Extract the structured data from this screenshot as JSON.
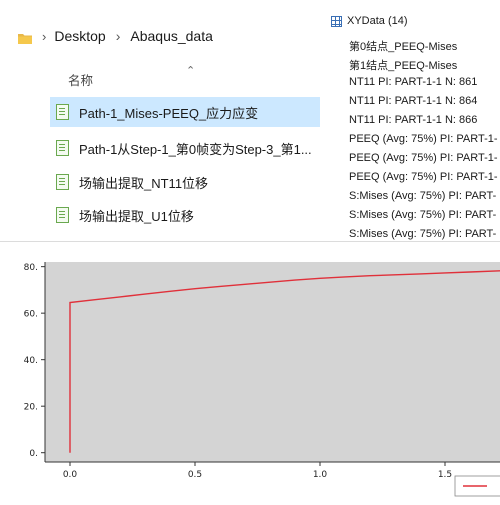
{
  "explorer": {
    "breadcrumb": [
      "Desktop",
      "Abaqus_data"
    ],
    "column_header": "名称",
    "files": [
      "Path-1_Mises-PEEQ_应力应变",
      "Path-1从Step-1_第0帧变为Step-3_第1...",
      "场输出提取_NT11位移",
      "场输出提取_U1位移"
    ],
    "selected_index": 0
  },
  "xydata_tree": {
    "root": "XYData (14)",
    "items": [
      "第0结点_PEEQ-Mises",
      "第1结点_PEEQ-Mises",
      "NT11 PI: PART-1-1 N: 861",
      "NT11 PI: PART-1-1 N: 864",
      "NT11 PI: PART-1-1 N: 866",
      "PEEQ (Avg: 75%) PI: PART-1-",
      "PEEQ (Avg: 75%) PI: PART-1-",
      "PEEQ (Avg: 75%) PI: PART-1-",
      "S:Mises (Avg: 75%) PI: PART-",
      "S:Mises (Avg: 75%) PI: PART-",
      "S:Mises (Avg: 75%) PI: PART-"
    ]
  },
  "chart_data": {
    "type": "line",
    "xlim": [
      -0.1,
      1.72
    ],
    "ylim": [
      -4,
      82
    ],
    "xticks": [
      0.0,
      0.5,
      1.0,
      1.5
    ],
    "xtick_labels": [
      "0.0",
      "0.5",
      "1.0",
      "1.5"
    ],
    "yticks": [
      0,
      20,
      40,
      60,
      80
    ],
    "ytick_labels": [
      "0.",
      "20.",
      "40.",
      "60.",
      "80."
    ],
    "grid": false,
    "legend": "bottom-right",
    "background": "#d4d4d4",
    "series": [
      {
        "color": "#e0303a",
        "x": [
          0.0,
          0.0,
          0.0,
          0.1,
          0.2,
          0.3,
          0.4,
          0.5,
          0.6,
          0.7,
          0.8,
          0.9,
          1.0,
          1.1,
          1.2,
          1.3,
          1.4,
          1.5,
          1.6,
          1.72
        ],
        "y": [
          0,
          64,
          64.6,
          65.8,
          67.0,
          68.2,
          69.4,
          70.5,
          71.5,
          72.4,
          73.3,
          74.2,
          75.0,
          75.6,
          76.1,
          76.5,
          76.9,
          77.3,
          77.7,
          78.2
        ]
      }
    ]
  }
}
